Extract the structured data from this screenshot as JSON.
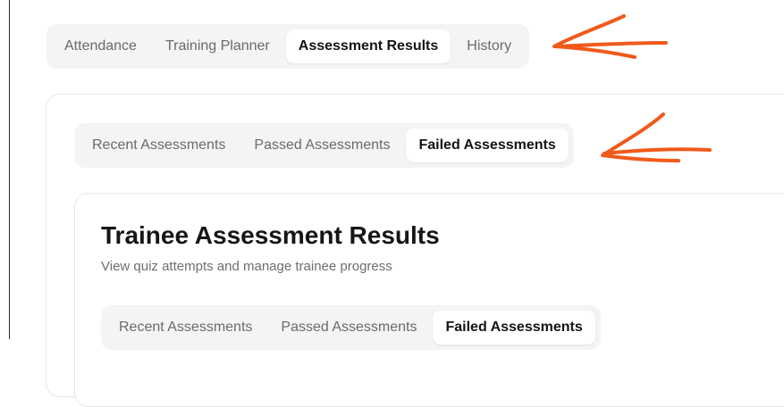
{
  "main_tabs": [
    "Attendance",
    "Training Planner",
    "Assessment Results",
    "History"
  ],
  "main_tabs_active": 2,
  "sub_tabs": [
    "Recent Assessments",
    "Passed Assessments",
    "Failed Assessments"
  ],
  "sub_tabs_active": 2,
  "card": {
    "title": "Trainee Assessment Results",
    "subtitle": "View quiz attempts and manage trainee progress"
  },
  "inner_tabs": [
    "Recent Assessments",
    "Passed Assessments",
    "Failed Assessments"
  ],
  "inner_tabs_active": 2,
  "colors": {
    "annotation": "#f05a1a",
    "active_tab_bg": "#ffffff",
    "tabbar_bg": "#f4f4f3"
  },
  "icons": {
    "annotation_arrow": "hand-drawn-arrow-icon"
  }
}
